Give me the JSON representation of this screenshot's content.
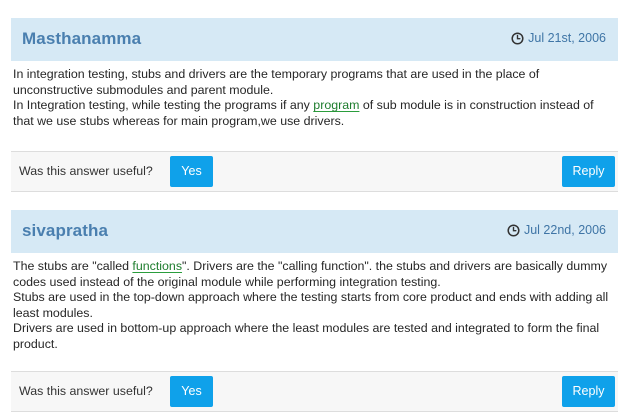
{
  "answers": [
    {
      "author": "Masthanamma",
      "date": "Jul 21st, 2006",
      "body": [
        [
          "In integration testing, stubs and drivers are the temporary programs that are used in the place of unconstructive submodules and parent module."
        ],
        [
          "In Integration testing, while testing the programs if any ",
          {
            "link": "program"
          },
          " of sub module  is in construction instead of that we use stubs whereas for main program,we use drivers."
        ]
      ],
      "useful_label": "Was this answer useful?",
      "yes_label": "Yes",
      "reply_label": "Reply"
    },
    {
      "author": "sivapratha",
      "date": "Jul 22nd, 2006",
      "body": [
        [
          "The stubs are \"called ",
          {
            "link": "functions"
          },
          "\". Drivers are the \"calling function\". the stubs and drivers are basically dummy codes used instead of the original module while performing integration testing."
        ],
        [
          "Stubs are used in the top-down approach where the testing starts from core product and ends with adding all least modules."
        ],
        [
          "Drivers are used in bottom-up approach where the least modules are tested and integrated to form the final product."
        ]
      ],
      "useful_label": "Was this answer useful?",
      "yes_label": "Yes",
      "reply_label": "Reply"
    }
  ],
  "icons": {
    "date_icon": "clock-icon"
  },
  "colors": {
    "header_bg": "#d6e9f5",
    "author": "#4a7faf",
    "date": "#3f75a6",
    "button": "#0fa1ea",
    "link": "#1e7d2e",
    "footer_bg": "#f7f7f7"
  }
}
